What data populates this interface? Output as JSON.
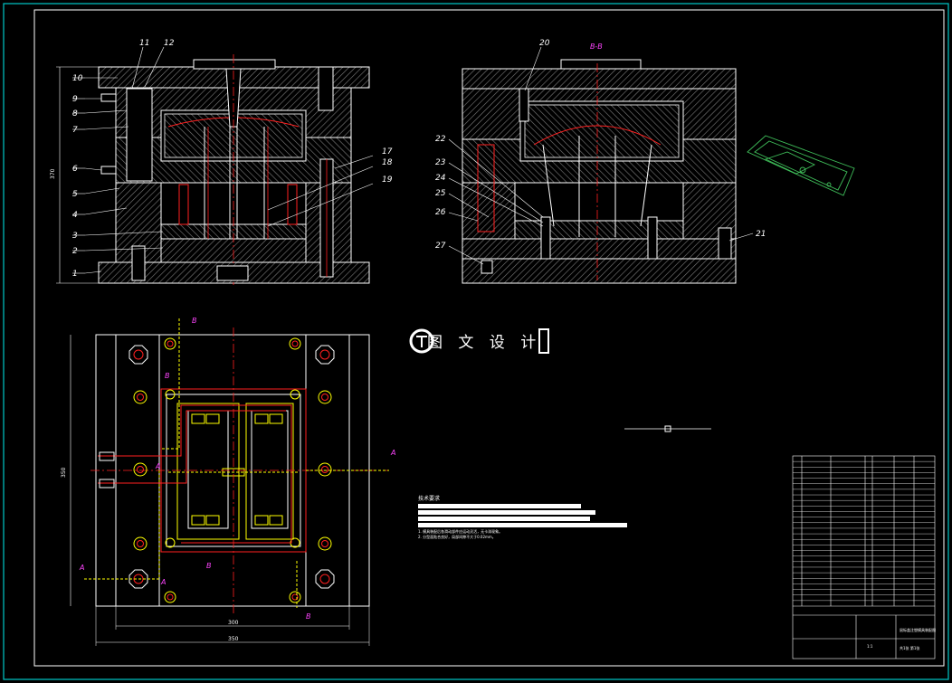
{
  "colors": {
    "background": "#000000",
    "frame": "#00c8c8",
    "outline": "#ffffff",
    "hatch": "#8c8c8c",
    "red": "#ff2020",
    "yellow": "#ffff00",
    "magenta": "#ff44ff",
    "green": "#3fbf5a"
  },
  "section_view": {
    "left_callouts": [
      "10",
      "9",
      "8",
      "7",
      "6",
      "5",
      "4",
      "3",
      "2",
      "1"
    ],
    "top_callouts": [
      "11",
      "12"
    ],
    "right_callouts": [
      "17",
      "18",
      "19"
    ],
    "height_dim": "370"
  },
  "bb_view": {
    "title": "B-B",
    "callouts_top": [
      "20"
    ],
    "callouts_left": [
      "22",
      "23",
      "24",
      "25",
      "26",
      "27"
    ],
    "callouts_right": [
      "21"
    ]
  },
  "plan_view": {
    "width_outer": "350",
    "width_inner": "300",
    "height": "350",
    "section_marks": [
      "A",
      "A",
      "B",
      "B",
      "B",
      "B",
      "A",
      "A"
    ]
  },
  "watermark": "图 文 设 计",
  "tech_req": {
    "title": "技术要求",
    "lines": [
      "1. 模具装配后各滑动部件应运动灵活，无卡滞现象。",
      "2. 分型面贴合良好，局部间隙不大于0.02mm。",
      "3. 顶出机构动作平稳，复位可靠，顶杆端面与型面平齐。",
      "4. 所有运动件保持清洁，装配前须涂抹润滑油。",
      "5. 各部冷却水道通水检验，不得有渗漏。"
    ]
  },
  "title_block": {
    "drawing_name": "鼠标盖注塑模具装配图",
    "scale": "1:1",
    "sheet": "共1张 第1张"
  }
}
